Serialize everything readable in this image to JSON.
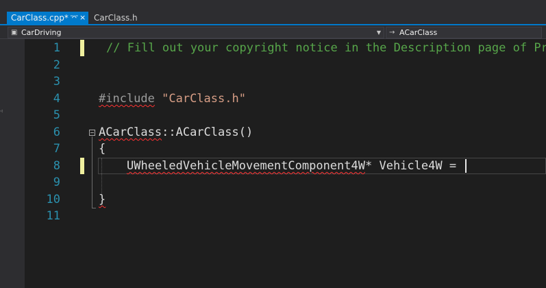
{
  "tabs": {
    "active": {
      "label": "CarClass.cpp*",
      "pin": "⌤",
      "close": "×"
    },
    "inactive": {
      "label": "CarClass.h"
    }
  },
  "navigation": {
    "project_icon": "▣",
    "project": "CarDriving",
    "member_icon": "→",
    "member": "ACarClass",
    "dropdown_icon": "▼"
  },
  "editor": {
    "line_numbers": [
      "1",
      "2",
      "3",
      "4",
      "5",
      "6",
      "7",
      "8",
      "9",
      "10",
      "11"
    ],
    "lines": {
      "comment": "// Fill out your copyright notice in the Description page of Pr",
      "include_kw": "#include",
      "include_str": " \"CarClass.h\"",
      "ctor_class": "ACarClass",
      "ctor_rest": "::ACarClass()",
      "open_brace": "{",
      "decl_type": "UWheeledVehicleMovementComponent4W",
      "decl_rest": "* Vehicle4W =",
      "close_brace": "}"
    }
  },
  "colors": {
    "accent": "#007acc",
    "comment": "#57a64a",
    "string": "#d69d85",
    "line_number": "#2b91af",
    "change_margin": "#efef9e"
  }
}
